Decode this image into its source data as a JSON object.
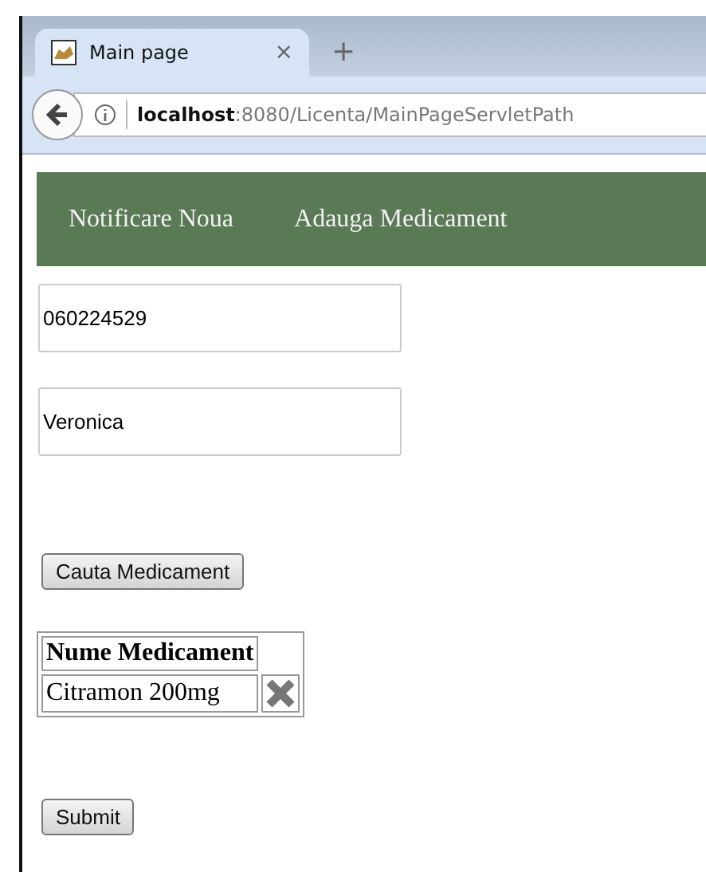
{
  "browser": {
    "tab": {
      "title": "Main page",
      "close": "×"
    },
    "new_tab": "+",
    "url": "**localhost**:8080/Licenta/MainPageServletPath"
  },
  "nav": [
    "Notificare Noua",
    "Adauga Medicament"
  ],
  "fields": [
    {
      "value": "060224529"
    },
    {
      "value": "Veronica"
    }
  ],
  "search_button": "Cauta Medicament",
  "table": {
    "columns": [
      "Nume Medicament"
    ],
    "rows": [
      {
        "cells": [
          "Citramon 200mg"
        ]
      }
    ]
  },
  "submit_button": "Submit"
}
